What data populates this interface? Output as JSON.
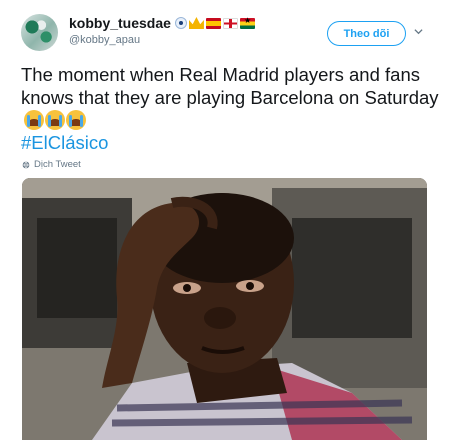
{
  "user": {
    "display_name": "kobby_tuesdae",
    "handle": "@kobby_apau",
    "badges": [
      "eye-badge",
      "crown-badge",
      "spain-flag",
      "england-flag",
      "ghana-flag"
    ]
  },
  "actions": {
    "follow_label": "Theo dõi",
    "more_icon": "chevron-down-icon"
  },
  "tweet": {
    "text": "The moment when Real Madrid players and fans knows that they are playing Barcelona on Saturday",
    "emoji_count": 3,
    "emoji_name": "loudly-crying-face",
    "hashtag": "#ElClásico",
    "translate_label": "Dịch Tweet"
  },
  "colors": {
    "accent": "#1da1f2",
    "link": "#1b95e0",
    "muted": "#657786",
    "text": "#14171a"
  }
}
